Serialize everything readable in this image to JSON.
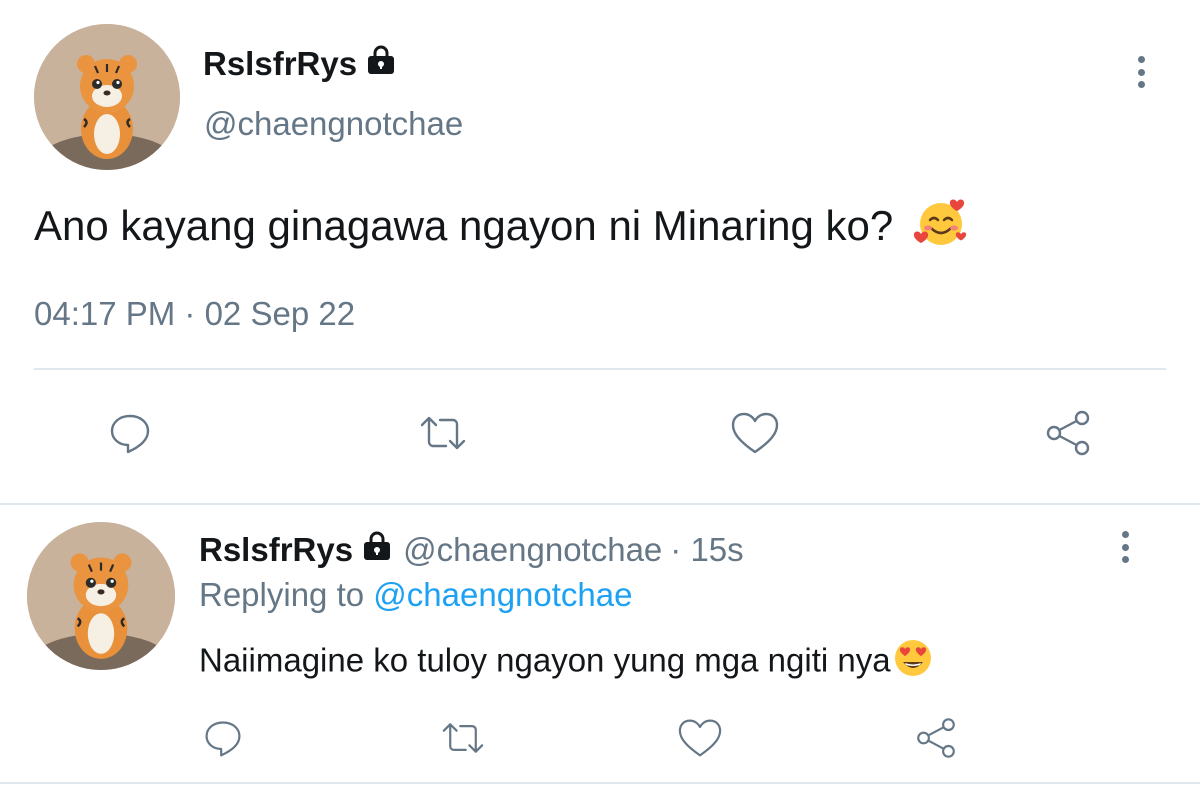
{
  "main_tweet": {
    "display_name": "RslsfrRys",
    "handle": "@chaengnotchae",
    "text": "Ano kayang ginagawa ngayon ni Minaring ko?",
    "timestamp": "04:17 PM · 02 Sep 22",
    "text_emoji": "smiling-face-with-hearts-emoji"
  },
  "reply_tweet": {
    "display_name": "RslsfrRys",
    "handle": "@chaengnotchae",
    "time": "· 15s",
    "replying_prefix": "Replying to",
    "replying_to": "@chaengnotchae",
    "text": "Naiimagine ko tuloy ngayon yung mga ngiti nya",
    "text_emoji": "heart-eyes-emoji"
  },
  "icons": {
    "lock": "lock-icon",
    "reply": "reply-icon",
    "retweet": "retweet-icon",
    "like": "heart-icon",
    "share": "share-icon",
    "more": "more-vertical-icon"
  },
  "colors": {
    "text": "#14171a",
    "muted": "#657786",
    "link": "#1da1f2",
    "divider": "#e1e8ed"
  }
}
